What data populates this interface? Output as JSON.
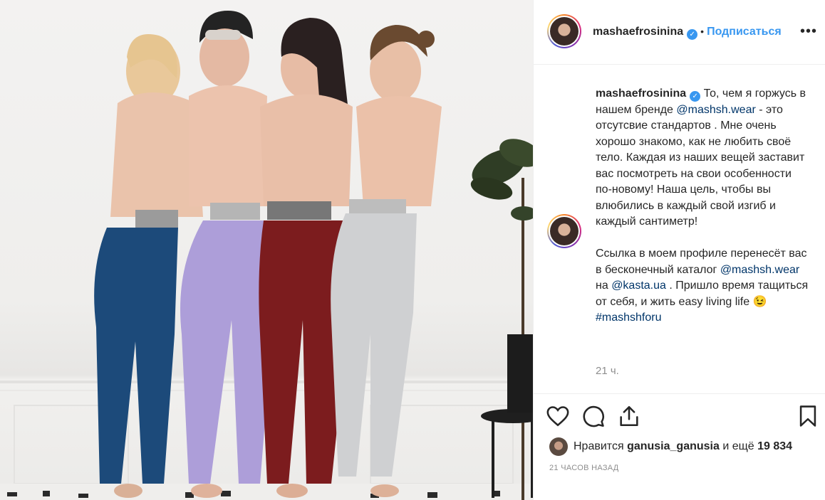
{
  "post": {
    "username": "mashaefrosinina",
    "follow_label": "Подписаться",
    "dot_separator": "•",
    "more_label": "•••",
    "caption": {
      "username": "mashaefrosinina",
      "line1_a": "То, чем я",
      "line2_a": "горжусь в нашем бренде",
      "mention1": "@mashsh.wear",
      "line3_b": " - это отсутсвие",
      "line4": "стандартов . Мне очень хорошо знакомо, как не любить своё тело. Каждая из наших вещей заставит вас посмотреть на свои особенности по-новому! Наша цель, чтобы вы влюбились в каждый свой изгиб и каждый сантиметр!",
      "para2_a": "Ссылка в моем профиле перенесёт вас в бесконечный каталог ",
      "mention2": "@mashsh.wear",
      "para2_b": " на ",
      "mention3": "@kasta.ua",
      "para2_c": " . Пришло время тащиться от себя, и жить easy living life ",
      "emoji": "😉",
      "hashtag": "#mashshforu"
    },
    "caption_time": "21 ч.",
    "likes": {
      "prefix": "Нравится ",
      "user": "ganusia_ganusia",
      "middle": " и ещё ",
      "count": "19 834"
    },
    "posted_ago": "21 ЧАСОВ НАЗАД"
  },
  "colors": {
    "accent": "#3897f0",
    "text": "#262626",
    "muted": "#8e8e8e",
    "link": "#003569"
  },
  "icons": [
    "heart-icon",
    "comment-icon",
    "share-icon",
    "bookmark-icon",
    "verified-icon",
    "more-icon"
  ]
}
